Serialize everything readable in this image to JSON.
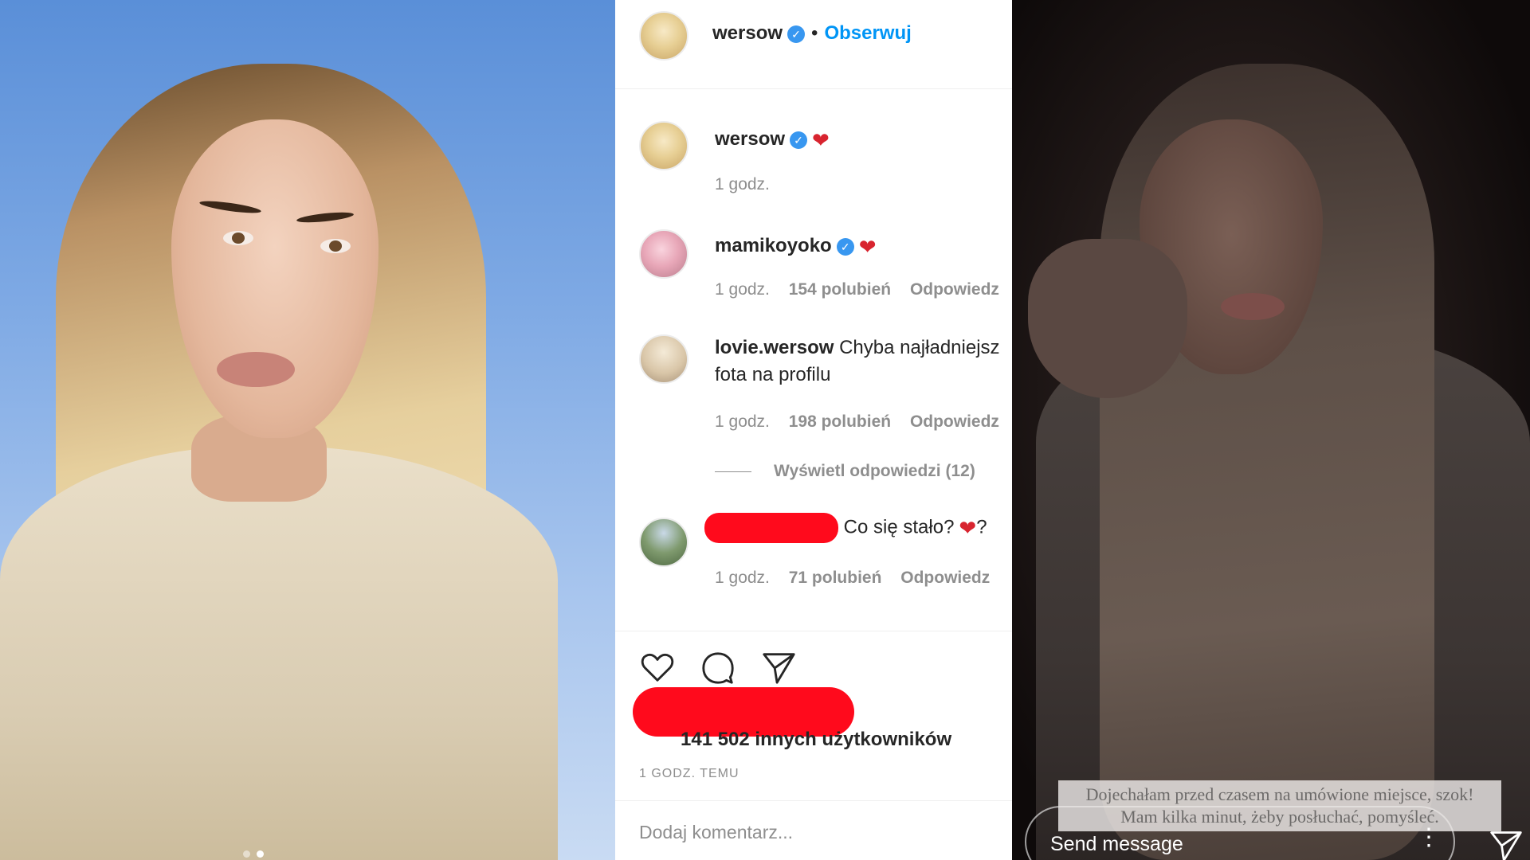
{
  "post_header": {
    "username": "wersow",
    "separator": "•",
    "follow_label": "Obserwuj"
  },
  "caption": {
    "username": "wersow",
    "emoji": "❤",
    "time": "1 godz."
  },
  "comments": [
    {
      "username": "mamikoyoko",
      "verified": true,
      "text": "❤",
      "time": "1 godz.",
      "likes": "154 polubień",
      "reply": "Odpowiedz"
    },
    {
      "username": "lovie.wersow",
      "text_line1": "Chyba najładniejsz",
      "text_line2": "fota na profilu",
      "time": "1 godz.",
      "likes": "198 polubień",
      "reply": "Odpowiedz",
      "view_replies": "Wyświetl odpowiedzi (12)"
    },
    {
      "username_redacted": true,
      "text": "Co się stało?",
      "emoji": "❤",
      "suffix": "?",
      "time": "1 godz.",
      "likes": "71 polubień",
      "reply": "Odpowiedz"
    }
  ],
  "actions": {
    "likes_text": "141 502 innych użytkowników",
    "timestamp": "1 GODZ. TEMU",
    "comment_placeholder": "Dodaj komentarz..."
  },
  "story": {
    "caption_line1": "Dojechałam przed czasem na umówione miejsce, szok!",
    "caption_line2": "Mam kilka minut, żeby posłuchać, pomyśleć.",
    "send_message": "Send message",
    "more": "⋮"
  },
  "colors": {
    "accent": "#0095f6",
    "verified": "#3897f0",
    "redaction": "#ff0a1c",
    "heart": "#d8242f"
  }
}
